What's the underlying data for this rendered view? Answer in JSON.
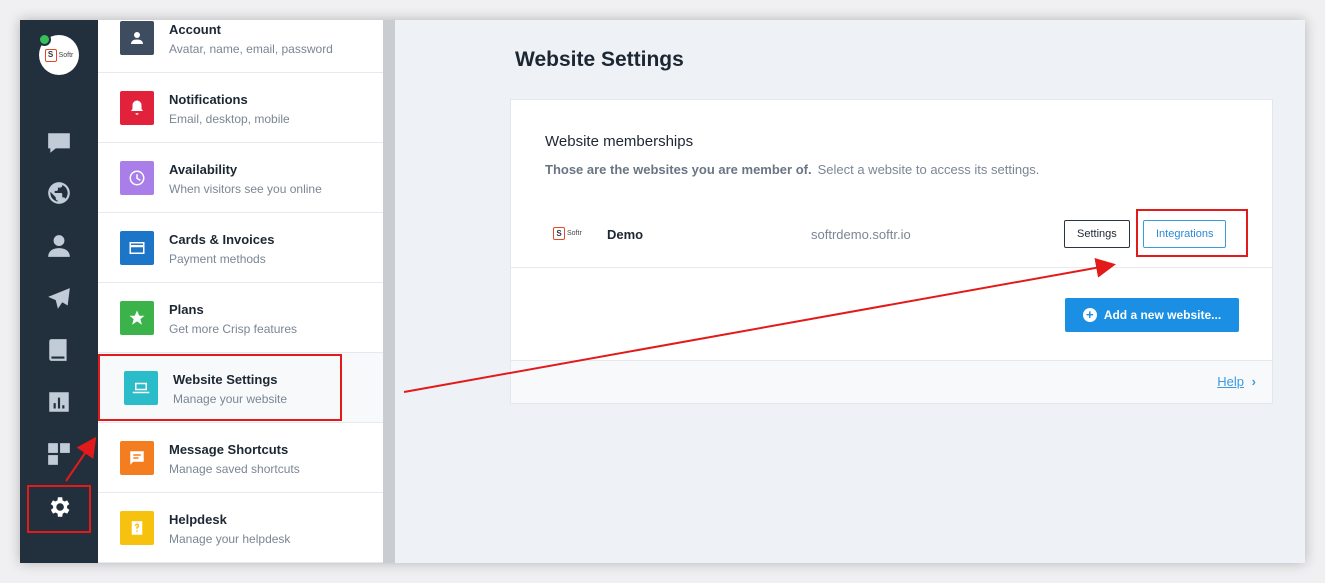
{
  "colors": {
    "rail_bg": "#22303e",
    "accent": "#1a8fe3",
    "annotation": "#e21a1a"
  },
  "rail": {
    "logo_text": "Softr",
    "logo_letter": "S",
    "icons": [
      "chat-icon",
      "globe-icon",
      "user-icon",
      "send-icon",
      "book-icon",
      "analytics-icon",
      "plugins-icon",
      "gear-icon"
    ]
  },
  "menu": {
    "items": [
      {
        "title": "Account",
        "subtitle": "Avatar, name, email, password",
        "icon": "user-icon",
        "color": "#3d4d5f"
      },
      {
        "title": "Notifications",
        "subtitle": "Email, desktop, mobile",
        "icon": "bell-icon",
        "color": "#e2223b"
      },
      {
        "title": "Availability",
        "subtitle": "When visitors see you online",
        "icon": "clock-icon",
        "color": "#a97ee8"
      },
      {
        "title": "Cards & Invoices",
        "subtitle": "Payment methods",
        "icon": "card-icon",
        "color": "#1d75c8"
      },
      {
        "title": "Plans",
        "subtitle": "Get more Crisp features",
        "icon": "star-icon",
        "color": "#3cb34a"
      },
      {
        "title": "Website Settings",
        "subtitle": "Manage your website",
        "icon": "laptop-icon",
        "color": "#2bbcc9"
      },
      {
        "title": "Message Shortcuts",
        "subtitle": "Manage saved shortcuts",
        "icon": "message-icon",
        "color": "#f47d20"
      },
      {
        "title": "Helpdesk",
        "subtitle": "Manage your helpdesk",
        "icon": "helpdesk-icon",
        "color": "#f6c20f"
      }
    ]
  },
  "main": {
    "title": "Website Settings",
    "card": {
      "heading": "Website memberships",
      "desc_bold": "Those are the websites you are member of.",
      "desc_rest": "Select a website to access its settings.",
      "site": {
        "logo_letter": "S",
        "logo_text": "Softr",
        "name": "Demo",
        "domain": "softrdemo.softr.io",
        "settings_label": "Settings",
        "integrations_label": "Integrations"
      },
      "add_label": "Add a new website...",
      "help_label": "Help",
      "help_chevron": "›"
    }
  }
}
